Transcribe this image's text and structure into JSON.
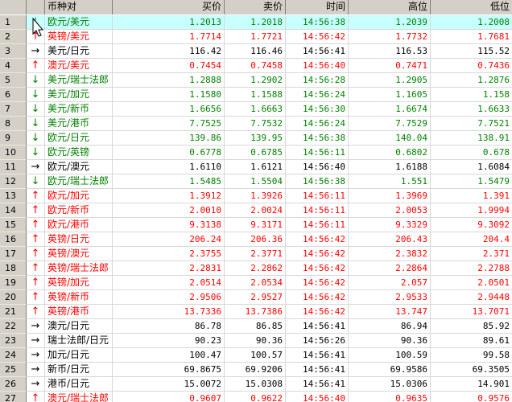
{
  "colors": {
    "up": "#ff0000",
    "down": "#008000",
    "flat": "#000000",
    "selected_row": "#c8ffff",
    "header_bg": "#d4d0c8"
  },
  "columns": [
    "",
    "",
    "币种对",
    "买价",
    "卖价",
    "时间",
    "高位",
    "低位"
  ],
  "rows": [
    {
      "idx": "1",
      "dir": "down",
      "pair": "欧元/美元",
      "bid": "1.2013",
      "ask": "1.2018",
      "time": "14:56:38",
      "high": "1.2039",
      "low": "1.2008"
    },
    {
      "idx": "2",
      "dir": "up",
      "pair": "英镑/美元",
      "bid": "1.7714",
      "ask": "1.7721",
      "time": "14:56:42",
      "high": "1.7732",
      "low": "1.7681"
    },
    {
      "idx": "3",
      "dir": "flat",
      "pair": "美元/日元",
      "bid": "116.42",
      "ask": "116.46",
      "time": "14:56:41",
      "high": "116.53",
      "low": "115.52"
    },
    {
      "idx": "4",
      "dir": "up",
      "pair": "澳元/美元",
      "bid": "0.7454",
      "ask": "0.7458",
      "time": "14:56:40",
      "high": "0.7471",
      "low": "0.7436"
    },
    {
      "idx": "5",
      "dir": "down",
      "pair": "美元/瑞士法郎",
      "bid": "1.2888",
      "ask": "1.2902",
      "time": "14:56:28",
      "high": "1.2905",
      "low": "1.2876"
    },
    {
      "idx": "6",
      "dir": "down",
      "pair": "美元/加元",
      "bid": "1.1580",
      "ask": "1.1588",
      "time": "14:56:24",
      "high": "1.1605",
      "low": "1.158"
    },
    {
      "idx": "7",
      "dir": "down",
      "pair": "美元/新币",
      "bid": "1.6656",
      "ask": "1.6663",
      "time": "14:56:30",
      "high": "1.6674",
      "low": "1.6633"
    },
    {
      "idx": "8",
      "dir": "down",
      "pair": "美元/港币",
      "bid": "7.7525",
      "ask": "7.7532",
      "time": "14:56:24",
      "high": "7.7529",
      "low": "7.7521"
    },
    {
      "idx": "9",
      "dir": "down",
      "pair": "欧元/日元",
      "bid": "139.86",
      "ask": "139.95",
      "time": "14:56:38",
      "high": "140.04",
      "low": "138.91"
    },
    {
      "idx": "10",
      "dir": "down",
      "pair": "欧元/英镑",
      "bid": "0.6778",
      "ask": "0.6785",
      "time": "14:56:11",
      "high": "0.6802",
      "low": "0.678"
    },
    {
      "idx": "11",
      "dir": "flat",
      "pair": "欧元/澳元",
      "bid": "1.6110",
      "ask": "1.6121",
      "time": "14:56:40",
      "high": "1.6188",
      "low": "1.6084"
    },
    {
      "idx": "12",
      "dir": "down",
      "pair": "欧元/瑞士法郎",
      "bid": "1.5485",
      "ask": "1.5504",
      "time": "14:56:38",
      "high": "1.551",
      "low": "1.5479"
    },
    {
      "idx": "13",
      "dir": "up",
      "pair": "欧元/加元",
      "bid": "1.3912",
      "ask": "1.3926",
      "time": "14:56:11",
      "high": "1.3969",
      "low": "1.391"
    },
    {
      "idx": "14",
      "dir": "up",
      "pair": "欧元/新币",
      "bid": "2.0010",
      "ask": "2.0024",
      "time": "14:56:11",
      "high": "2.0053",
      "low": "1.9994"
    },
    {
      "idx": "15",
      "dir": "up",
      "pair": "欧元/港币",
      "bid": "9.3138",
      "ask": "9.3171",
      "time": "14:56:11",
      "high": "9.3329",
      "low": "9.3092"
    },
    {
      "idx": "16",
      "dir": "up",
      "pair": "英镑/日元",
      "bid": "206.24",
      "ask": "206.36",
      "time": "14:56:42",
      "high": "206.43",
      "low": "204.4"
    },
    {
      "idx": "17",
      "dir": "up",
      "pair": "英镑/澳元",
      "bid": "2.3755",
      "ask": "2.3771",
      "time": "14:56:42",
      "high": "2.3832",
      "low": "2.371"
    },
    {
      "idx": "18",
      "dir": "up",
      "pair": "英镑/瑞士法郎",
      "bid": "2.2831",
      "ask": "2.2862",
      "time": "14:56:42",
      "high": "2.2864",
      "low": "2.2788"
    },
    {
      "idx": "19",
      "dir": "up",
      "pair": "英镑/加元",
      "bid": "2.0514",
      "ask": "2.0534",
      "time": "14:56:42",
      "high": "2.057",
      "low": "2.0501"
    },
    {
      "idx": "20",
      "dir": "up",
      "pair": "英镑/新币",
      "bid": "2.9506",
      "ask": "2.9527",
      "time": "14:56:42",
      "high": "2.9533",
      "low": "2.9448"
    },
    {
      "idx": "21",
      "dir": "up",
      "pair": "英镑/港币",
      "bid": "13.7336",
      "ask": "13.7386",
      "time": "14:56:42",
      "high": "13.747",
      "low": "13.7071"
    },
    {
      "idx": "22",
      "dir": "flat",
      "pair": "澳元/日元",
      "bid": "86.78",
      "ask": "86.85",
      "time": "14:56:41",
      "high": "86.94",
      "low": "85.92"
    },
    {
      "idx": "23",
      "dir": "flat",
      "pair": "瑞士法郎/日元",
      "bid": "90.23",
      "ask": "90.36",
      "time": "14:56:26",
      "high": "90.36",
      "low": "89.61"
    },
    {
      "idx": "24",
      "dir": "flat",
      "pair": "加元/日元",
      "bid": "100.47",
      "ask": "100.57",
      "time": "14:56:41",
      "high": "100.59",
      "low": "99.58"
    },
    {
      "idx": "25",
      "dir": "flat",
      "pair": "新币/日元",
      "bid": "69.8675",
      "ask": "69.9206",
      "time": "14:56:41",
      "high": "69.9586",
      "low": "69.3505"
    },
    {
      "idx": "26",
      "dir": "flat",
      "pair": "港币/日元",
      "bid": "15.0072",
      "ask": "15.0308",
      "time": "14:56:41",
      "high": "15.0306",
      "low": "14.901"
    },
    {
      "idx": "27",
      "dir": "up",
      "pair": "澳元/瑞士法郎",
      "bid": "0.9607",
      "ask": "0.9622",
      "time": "14:56:40",
      "high": "0.9635",
      "low": "0.9576"
    }
  ],
  "arrow_glyphs": {
    "up": "↑",
    "down": "↓",
    "flat": "→"
  }
}
